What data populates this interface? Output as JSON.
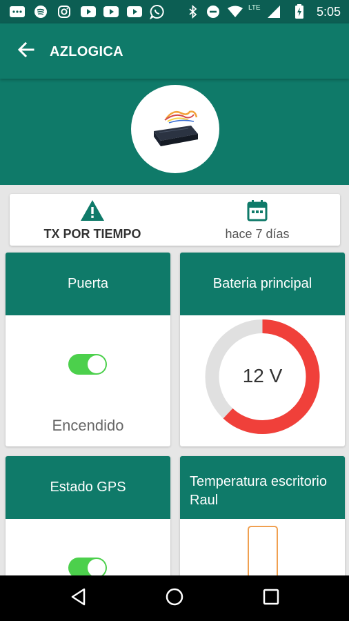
{
  "status_bar": {
    "time": "5:05",
    "network": "LTE",
    "left_icons": [
      "message-icon",
      "spotify-icon",
      "instagram-icon",
      "youtube-icon",
      "youtube-icon",
      "youtube-icon",
      "whatsapp-icon"
    ],
    "right_icons": [
      "bluetooth-icon",
      "do-not-disturb-icon",
      "wifi-icon",
      "signal-icon",
      "battery-icon"
    ]
  },
  "app_bar": {
    "title": "AZLOGICA",
    "back_icon": "arrow-back-icon"
  },
  "header": {
    "device_image": "gps-tracker-device"
  },
  "tx_card": {
    "mode_label": "TX POR TIEMPO",
    "mode_icon": "warning-icon",
    "last_update": "hace 7 días",
    "date_icon": "calendar-icon"
  },
  "tiles": {
    "puerta": {
      "title": "Puerta",
      "status": "Encendido",
      "toggle_on": true
    },
    "bateria": {
      "title": "Bateria principal",
      "value": "12 V",
      "gauge_fraction": 0.62
    },
    "gps": {
      "title": "Estado GPS",
      "toggle_on": true
    },
    "temperatura": {
      "title": "Temperatura escritorio Raul"
    }
  },
  "colors": {
    "status_bar": "#0c5e53",
    "primary": "#0f7a69",
    "toggle_on": "#4cd04c",
    "gauge_fill": "#f0403a",
    "gauge_track": "#e0e0e0",
    "thermo_outline": "#f0a050",
    "background": "#e6e6e6"
  },
  "nav_bar": {
    "icons": [
      "back-triangle-icon",
      "home-circle-icon",
      "recents-square-icon"
    ]
  }
}
